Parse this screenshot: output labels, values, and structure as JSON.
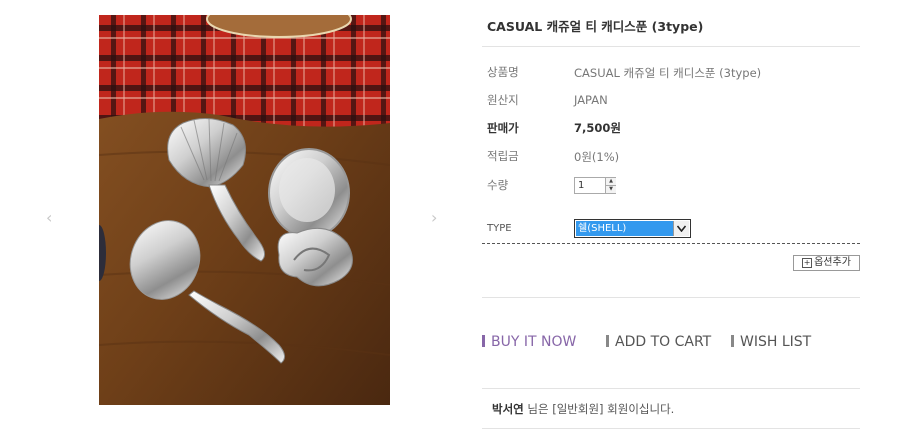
{
  "product": {
    "title": "CASUAL 캐쥬얼 티 캐디스푼 (3type)",
    "image_alt": "silver caddy spoons"
  },
  "details": {
    "name_label": "상품명",
    "name_value": "CASUAL 캐쥬얼 티 캐디스푼 (3type)",
    "origin_label": "원산지",
    "origin_value": "JAPAN",
    "price_label": "판매가",
    "price_value": "7,500원",
    "points_label": "적립금",
    "points_value": "0원(1%)",
    "qty_label": "수량",
    "qty_value": "1"
  },
  "options": {
    "type_label": "TYPE",
    "type_selected": "쉘(SHELL)",
    "add_option_label": "옵션추가"
  },
  "actions": {
    "buy_now": "BUY IT NOW",
    "add_to_cart": "ADD TO CART",
    "wish_list": "WISH LIST"
  },
  "member": {
    "name": "박서연",
    "suffix": " 님은 [일반회원] 회원이십니다."
  },
  "colors": {
    "accent": "#8766a8",
    "select_highlight": "#3399ee"
  },
  "icons": {
    "prev": "chevron-left-icon",
    "next": "chevron-right-icon",
    "plus": "plus-box-icon"
  }
}
